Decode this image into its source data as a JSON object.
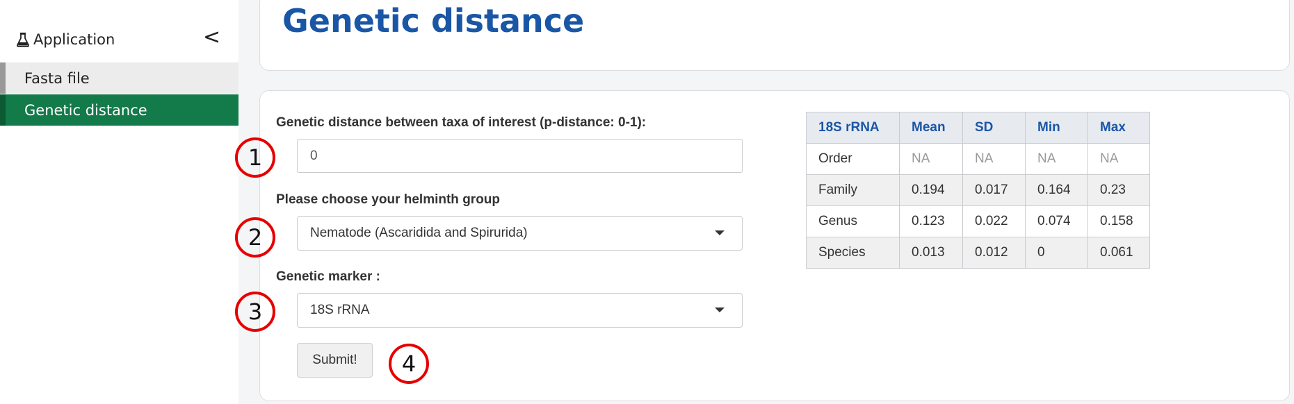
{
  "sidebar": {
    "app_label": "Application",
    "collapse_label": "<",
    "items": [
      {
        "label": "Fasta file"
      },
      {
        "label": "Genetic distance"
      }
    ]
  },
  "header": {
    "title": "Genetic distance"
  },
  "form": {
    "distance_label": "Genetic distance between taxa of interest (p-distance: 0-1):",
    "distance_value": "0",
    "group_label": "Please choose your helminth group",
    "group_value": "Nematode (Ascaridida and Spirurida)",
    "marker_label": "Genetic marker :",
    "marker_value": "18S rRNA",
    "submit_label": "Submit!"
  },
  "annotations": [
    "1",
    "2",
    "3",
    "4"
  ],
  "table": {
    "headers": [
      "18S rRNA",
      "Mean",
      "SD",
      "Min",
      "Max"
    ],
    "rows": [
      [
        "Order",
        "NA",
        "NA",
        "NA",
        "NA"
      ],
      [
        "Family",
        "0.194",
        "0.017",
        "0.164",
        "0.23"
      ],
      [
        "Genus",
        "0.123",
        "0.022",
        "0.074",
        "0.158"
      ],
      [
        "Species",
        "0.013",
        "0.012",
        "0",
        "0.061"
      ]
    ]
  },
  "colors": {
    "accent_green": "#137a4a",
    "title_blue": "#1a56a6",
    "marker_red": "#e60000"
  }
}
